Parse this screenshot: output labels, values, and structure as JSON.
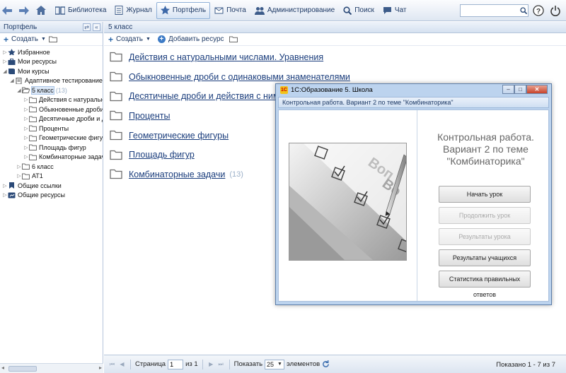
{
  "toolbar": {
    "items": [
      {
        "label": "Библиотека",
        "icon": "library-icon"
      },
      {
        "label": "Журнал",
        "icon": "journal-icon"
      },
      {
        "label": "Портфель",
        "icon": "star-icon",
        "active": true
      },
      {
        "label": "Почта",
        "icon": "mail-icon"
      },
      {
        "label": "Администрирование",
        "icon": "people-icon"
      },
      {
        "label": "Поиск",
        "icon": "search-icon"
      },
      {
        "label": "Чат",
        "icon": "chat-icon"
      }
    ],
    "search_value": ""
  },
  "left_panel": {
    "title": "Портфель",
    "create_label": "Создать",
    "tree": [
      {
        "label": "Избранное",
        "level": 0,
        "icon": "star-icon",
        "expander": "closed",
        "count": ""
      },
      {
        "label": "Мои ресурсы",
        "level": 0,
        "icon": "briefcase-icon",
        "expander": "closed",
        "count": ""
      },
      {
        "label": "Мои курсы",
        "level": 0,
        "icon": "book-icon",
        "expander": "open",
        "count": ""
      },
      {
        "label": "Адаптивное тестирование",
        "level": 1,
        "icon": "doc-icon",
        "expander": "open",
        "count": "(1"
      },
      {
        "label": "5 класс",
        "level": 2,
        "icon": "folder-open-icon",
        "expander": "open",
        "count": "(13)",
        "selected": true
      },
      {
        "label": "Действия с натуральн",
        "level": 3,
        "icon": "folder-icon",
        "expander": "closed",
        "count": ""
      },
      {
        "label": "Обыкновенные дроби",
        "level": 3,
        "icon": "folder-icon",
        "expander": "closed",
        "count": ""
      },
      {
        "label": "Десятичные дроби и д",
        "level": 3,
        "icon": "folder-icon",
        "expander": "closed",
        "count": ""
      },
      {
        "label": "Проценты",
        "level": 3,
        "icon": "folder-icon",
        "expander": "closed",
        "count": ""
      },
      {
        "label": "Геометрические фигур",
        "level": 3,
        "icon": "folder-icon",
        "expander": "closed",
        "count": ""
      },
      {
        "label": "Площадь фигур",
        "level": 3,
        "icon": "folder-icon",
        "expander": "closed",
        "count": ""
      },
      {
        "label": "Комбинаторные задач",
        "level": 3,
        "icon": "folder-icon",
        "expander": "closed",
        "count": ""
      },
      {
        "label": "6 класс",
        "level": 2,
        "icon": "folder-icon",
        "expander": "closed",
        "count": ""
      },
      {
        "label": "АТ1",
        "level": 2,
        "icon": "folder-icon",
        "expander": "closed",
        "count": ""
      },
      {
        "label": "Общие ссылки",
        "level": 0,
        "icon": "bookmark-icon",
        "expander": "closed",
        "count": ""
      },
      {
        "label": "Общие ресурсы",
        "level": 0,
        "icon": "shared-icon",
        "expander": "closed",
        "count": ""
      }
    ]
  },
  "main": {
    "breadcrumb": "5 класс",
    "create_label": "Создать",
    "add_resource_label": "Добавить ресурс",
    "folders": [
      {
        "label": "Действия с натуральными числами. Уравнения",
        "count": ""
      },
      {
        "label": "Обыкновенные дроби с одинаковыми знаменателями",
        "count": ""
      },
      {
        "label": "Десятичные дроби и действия с ними",
        "count": ""
      },
      {
        "label": "Проценты",
        "count": ""
      },
      {
        "label": "Геометрические фигуры",
        "count": ""
      },
      {
        "label": "Площадь фигур",
        "count": ""
      },
      {
        "label": "Комбинаторные задачи",
        "count": "(13)"
      }
    ],
    "pager": {
      "page_label": "Страница",
      "page_value": "1",
      "of_label": "из 1",
      "show_label": "Показать",
      "per_page": "25",
      "elements_label": "элементов",
      "info": "Показано 1 - 7 из 7"
    }
  },
  "dialog": {
    "title": "1С:Образование 5. Школа",
    "subtitle": "Контрольная работа. Вариант 2 по теме \"Комбинаторика\"",
    "heading": "Контрольная работа. Вариант 2 по теме \"Комбинаторика\"",
    "buttons": [
      {
        "label": "Начать урок",
        "enabled": true
      },
      {
        "label": "Продолжить урок",
        "enabled": false
      },
      {
        "label": "Результаты урока",
        "enabled": false
      },
      {
        "label": "Результаты учащихся",
        "enabled": true
      },
      {
        "label": "Статистика правильных ответов",
        "enabled": true
      }
    ]
  },
  "colors": {
    "link": "#1a3d7c",
    "panel": "#d5e1f0",
    "folder": "#6d6d6d"
  }
}
